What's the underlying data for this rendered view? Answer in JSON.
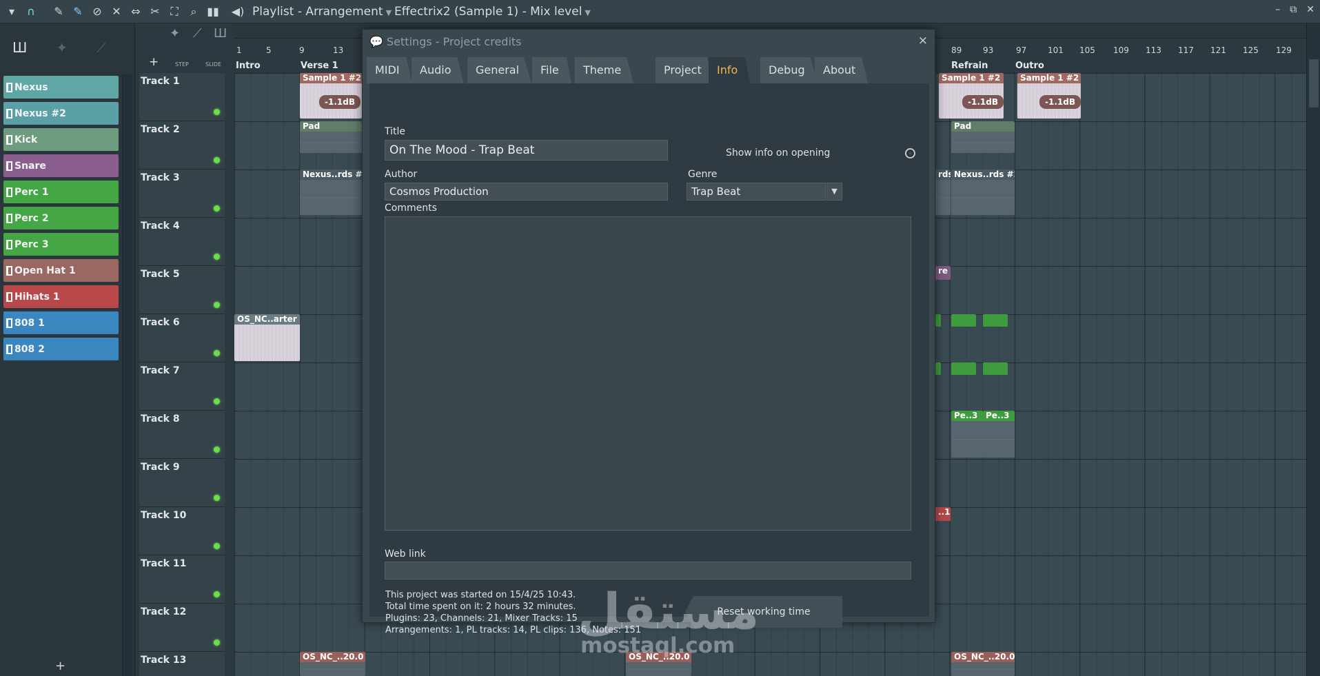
{
  "toolbar": {
    "title": "Playlist - Arrangement",
    "pattern": "Effectrix2 (Sample 1) - Mix level",
    "icons": [
      "menu-arrow-icon",
      "magnet-icon",
      "pencil-icon",
      "paint-icon",
      "delete-icon",
      "mute-icon",
      "slip-icon",
      "slice-icon",
      "select-icon",
      "zoom-icon",
      "playback-icon",
      "speaker-icon"
    ]
  },
  "window_controls": {
    "minimize": "–",
    "restore": "⧉",
    "close": "✕"
  },
  "channels": [
    {
      "name": "Nexus",
      "color": "#5fa7a6"
    },
    {
      "name": "Nexus #2",
      "color": "#5aa0a6"
    },
    {
      "name": "Kick",
      "color": "#6d9c7e"
    },
    {
      "name": "Snare",
      "color": "#8a5f8d"
    },
    {
      "name": "Perc 1",
      "color": "#45a645"
    },
    {
      "name": "Perc 2",
      "color": "#45a645"
    },
    {
      "name": "Perc 3",
      "color": "#45a645"
    },
    {
      "name": "Open Hat 1",
      "color": "#9a6761"
    },
    {
      "name": "Hihats 1",
      "color": "#b9484b"
    },
    {
      "name": "808 1",
      "color": "#3a86bf"
    },
    {
      "name": "808 2",
      "color": "#3a86bf"
    }
  ],
  "playlist_head": {
    "step": "STEP",
    "slide": "SLIDE",
    "add": "+"
  },
  "tracks": [
    "Track 1",
    "Track 2",
    "Track 3",
    "Track 4",
    "Track 5",
    "Track 6",
    "Track 7",
    "Track 8",
    "Track 9",
    "Track 10",
    "Track 11",
    "Track 12",
    "Track 13"
  ],
  "ruler": {
    "bars": [
      "1",
      "5",
      "9",
      "13",
      "89",
      "93",
      "97",
      "101",
      "105",
      "109",
      "113",
      "117",
      "121",
      "125",
      "129"
    ],
    "markers": [
      "Intro",
      "Verse 1",
      "Refrain",
      "Outro"
    ]
  },
  "clips": {
    "sample1": "Sample 1 #2",
    "pad": "Pad",
    "nexus": "Nexus..rds #2",
    "nexus_short": "Nexus..rds #",
    "rds": "rds",
    "re": "re",
    "os_arter": "OS_NC..arter",
    "os_200": "OS_NC_..20.0",
    "os_200b": "OS_NC_..20.0",
    "pe3": "Pe..3",
    "one": "..1",
    "db": "-1.1dB"
  },
  "dialog": {
    "title": "Settings - Project credits",
    "close": "×",
    "tabs": [
      "MIDI",
      "Audio",
      "General",
      "File",
      "Theme",
      "Project",
      "Info",
      "Debug",
      "About"
    ],
    "active_tab": "Info",
    "title_label": "Title",
    "title_value": "On The Mood - Trap Beat",
    "show_info": "Show info on opening",
    "author_label": "Author",
    "author_value": "Cosmos Production",
    "genre_label": "Genre",
    "genre_value": "Trap Beat",
    "comments_label": "Comments",
    "comments_value": "",
    "weblink_label": "Web link",
    "weblink_value": "",
    "stats": [
      "This project was started on 15/4/25 10:43.",
      "Total time spent on it:  2 hours 32 minutes.",
      "Plugins: 23, Channels: 21, Mixer Tracks: 15",
      "Arrangements: 1, PL tracks: 14, PL clips: 136, Notes: 151"
    ],
    "reset_button": "Reset working time"
  },
  "watermark": {
    "arabic": "مستقل",
    "latin": "mostaql.com"
  }
}
